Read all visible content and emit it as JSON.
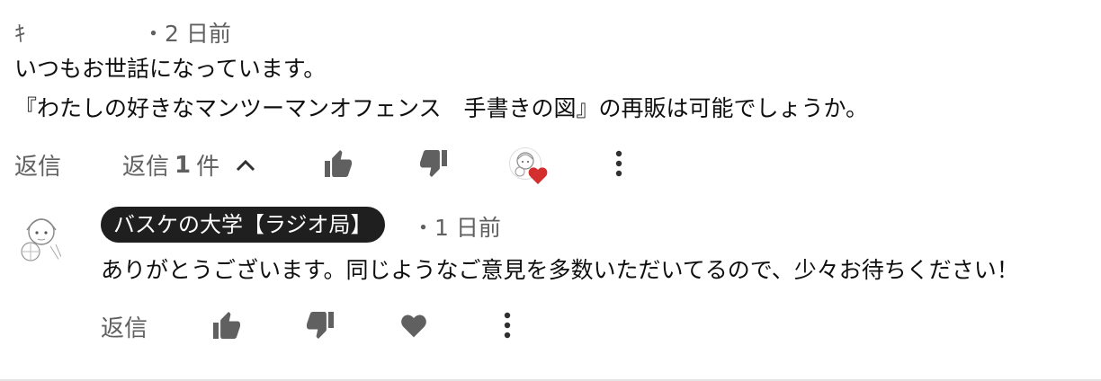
{
  "comment": {
    "author_fragment": "ｷ",
    "time": "・2 日前",
    "lines": [
      "いつもお世話になっています。",
      "『わたしの好きなマンツーマンオフェンス　手書きの図』の再販は可能でしょうか。"
    ],
    "actions": {
      "reply": "返信",
      "replies_prefix": "返信",
      "replies_count": "1",
      "replies_suffix": "件"
    }
  },
  "reply": {
    "author": "バスケの大学【ラジオ局】",
    "time": "・1 日前",
    "text": "ありがとうございます。同じようなご意見を多数いただいてるので、少々お待ちください！",
    "actions": {
      "reply": "返信"
    }
  },
  "icons": {
    "chevron": "chevron-up-icon",
    "like": "thumbs-up-icon",
    "dislike": "thumbs-down-icon",
    "heart": "heart-icon",
    "more": "more-vert-icon"
  },
  "colors": {
    "heart_red": "#d32f2f",
    "icon_gray": "#606060",
    "chip_bg": "#1f1f1f"
  }
}
